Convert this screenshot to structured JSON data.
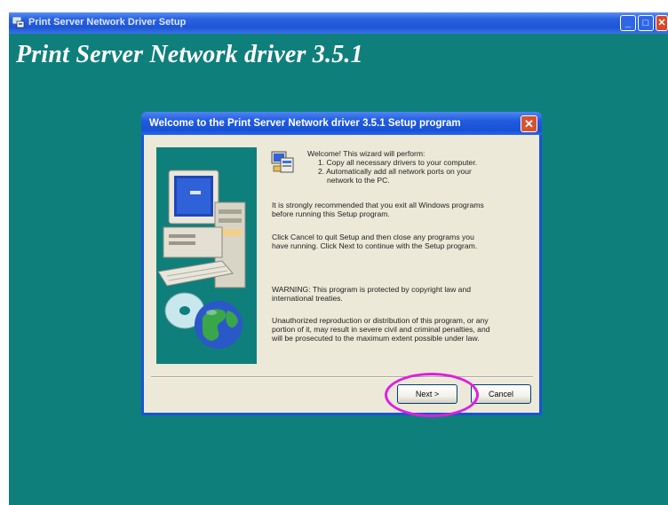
{
  "window": {
    "title": "Print Server Network Driver Setup",
    "minimize_glyph": "_",
    "maximize_glyph": "□",
    "close_glyph": "✕"
  },
  "banner": {
    "title": "Print Server Network driver 3.5.1"
  },
  "dialog": {
    "title": "Welcome to the Print Server Network driver 3.5.1 Setup program",
    "close_glyph": "✕",
    "welcome": {
      "heading": "Welcome!  This wizard will perform:",
      "step1": "1. Copy all necessary drivers to your computer.",
      "step2a": "2. Automatically add all network ports on your",
      "step2b": "network to the PC."
    },
    "recommend": [
      "It is strongly recommended that you exit all Windows programs",
      "before running this Setup program."
    ],
    "instructions": [
      "Click Cancel to quit Setup and then close any programs you",
      "have running.  Click Next to continue with the Setup program."
    ],
    "warning": [
      "WARNING:  This program is protected by copyright law and",
      "international treaties."
    ],
    "legal": [
      "Unauthorized reproduction or distribution of this program, or any",
      "portion of it, may result in severe civil and criminal penalties, and",
      "will be prosecuted to the maximum extent possible under law."
    ],
    "buttons": {
      "next": "Next >",
      "cancel": "Cancel"
    }
  },
  "colors": {
    "desktop": "#0f7f7c",
    "titlebar": "#1f5be0",
    "dialog_face": "#ece9d8",
    "highlight": "#e01ee0"
  }
}
